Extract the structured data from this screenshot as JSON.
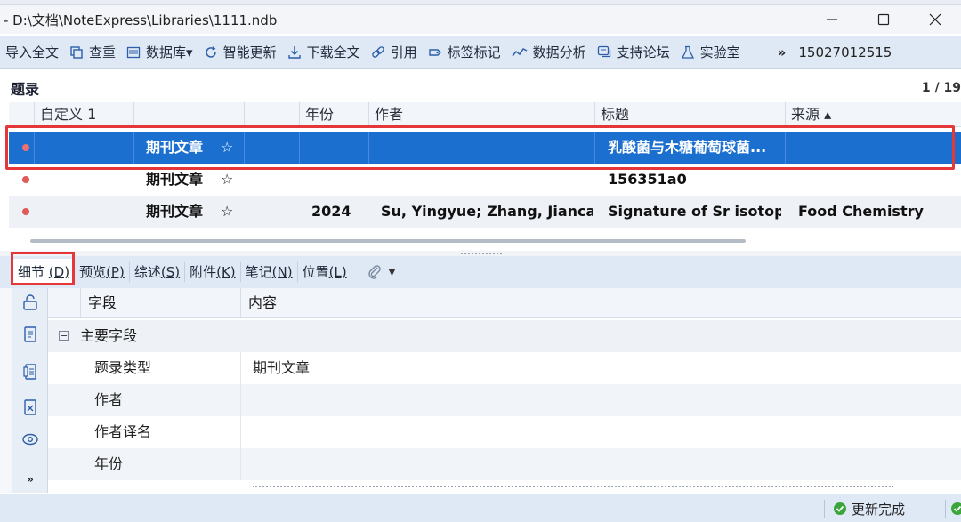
{
  "window": {
    "title": "- D:\\文档\\NoteExpress\\Libraries\\1111.ndb",
    "minimize_icon": "minimize-icon",
    "maximize_icon": "maximize-icon",
    "close_icon": "close-icon"
  },
  "toolbar": {
    "items": [
      {
        "label": "导入全文",
        "icon": "none"
      },
      {
        "label": "查重",
        "icon": "duplicate-icon"
      },
      {
        "label": "数据库▾",
        "icon": "database-icon"
      },
      {
        "label": "智能更新",
        "icon": "refresh-icon"
      },
      {
        "label": "下载全文",
        "icon": "download-icon"
      },
      {
        "label": "引用",
        "icon": "link-icon"
      },
      {
        "label": "标签标记",
        "icon": "tag-icon"
      },
      {
        "label": "数据分析",
        "icon": "chart-icon"
      },
      {
        "label": "支持论坛",
        "icon": "forum-icon"
      },
      {
        "label": "实验室",
        "icon": "flask-icon"
      }
    ],
    "more": "»",
    "user": "15027012515"
  },
  "records": {
    "title": "题录",
    "pager": "1 / 19",
    "columns": [
      "自定义 1",
      "",
      "",
      "年份",
      "作者",
      "标题",
      "来源 ▴"
    ],
    "rows": [
      {
        "type": "期刊文章",
        "year": "",
        "author": "",
        "title": "乳酸菌与木糖葡萄球菌...",
        "source": "",
        "selected": true
      },
      {
        "type": "期刊文章",
        "year": "",
        "author": "",
        "title": "156351a0",
        "source": "",
        "selected": false
      },
      {
        "type": "期刊文章",
        "year": "2024",
        "author": "Su, Yingyue; Zhang, Jiancai;",
        "title": "Signature of Sr isotop..",
        "source": "Food Chemistry",
        "selected": false
      }
    ]
  },
  "detail_tabs": [
    {
      "label": "细节",
      "key": "(D)"
    },
    {
      "label": "预览",
      "key": "(P)"
    },
    {
      "label": "综述",
      "key": "(S)"
    },
    {
      "label": "附件",
      "key": "(K)"
    },
    {
      "label": "笔记",
      "key": "(N)"
    },
    {
      "label": "位置",
      "key": "(L)"
    }
  ],
  "detail": {
    "col_field": "字段",
    "col_content": "内容",
    "group_label": "主要字段",
    "group_toggle": "−",
    "fields": [
      {
        "name": "题录类型",
        "value": "期刊文章"
      },
      {
        "name": "作者",
        "value": ""
      },
      {
        "name": "作者译名",
        "value": ""
      },
      {
        "name": "年份",
        "value": ""
      }
    ]
  },
  "status": {
    "update_done": "更新完成"
  },
  "colors": {
    "selection": "#1b6fcf",
    "highlight": "#e5373a",
    "toolbar_bg": "#dfe8f5",
    "dot": "#e05a5a"
  }
}
